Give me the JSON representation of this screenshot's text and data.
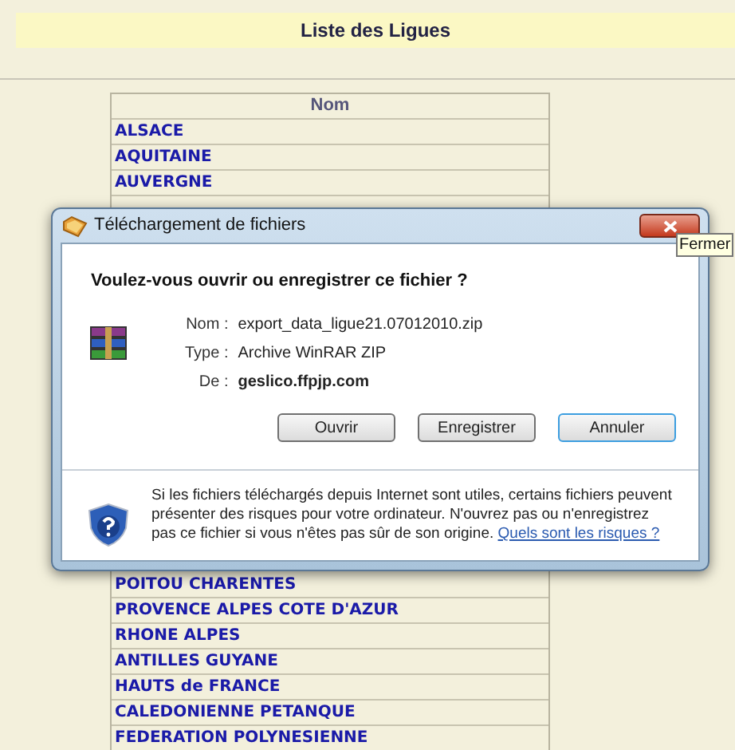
{
  "page": {
    "title": "Liste des Ligues"
  },
  "table": {
    "columns": [
      "Nom"
    ],
    "rows_top": [
      "ALSACE",
      "AQUITAINE",
      "AUVERGNE"
    ],
    "rows_bottom": [
      "POITOU CHARENTES",
      "PROVENCE ALPES COTE D'AZUR",
      "RHONE ALPES",
      "ANTILLES GUYANE",
      "HAUTS de FRANCE",
      "CALEDONIENNE PETANQUE",
      "FEDERATION POLYNESIENNE"
    ]
  },
  "dialog": {
    "title": "Téléchargement de fichiers",
    "close_tooltip": "Fermer",
    "question": "Voulez-vous ouvrir ou enregistrer ce fichier ?",
    "fields": [
      {
        "label": "Nom :",
        "value": "export_data_ligue21.07012010.zip",
        "bold": false
      },
      {
        "label": "Type :",
        "value": "Archive WinRAR ZIP",
        "bold": false
      },
      {
        "label": "De :",
        "value": "geslico.ffpjp.com",
        "bold": true
      }
    ],
    "buttons": [
      {
        "label": "Ouvrir",
        "default": false
      },
      {
        "label": "Enregistrer",
        "default": false
      },
      {
        "label": "Annuler",
        "default": true
      }
    ],
    "warning": "Si les fichiers téléchargés depuis Internet sont utiles, certains fichiers peuvent présenter des risques pour votre ordinateur. N'ouvrez pas ou n'enregistrez pas ce fichier si vous n'êtes pas sûr de son origine.",
    "warning_link": "Quels sont les risques ?"
  }
}
